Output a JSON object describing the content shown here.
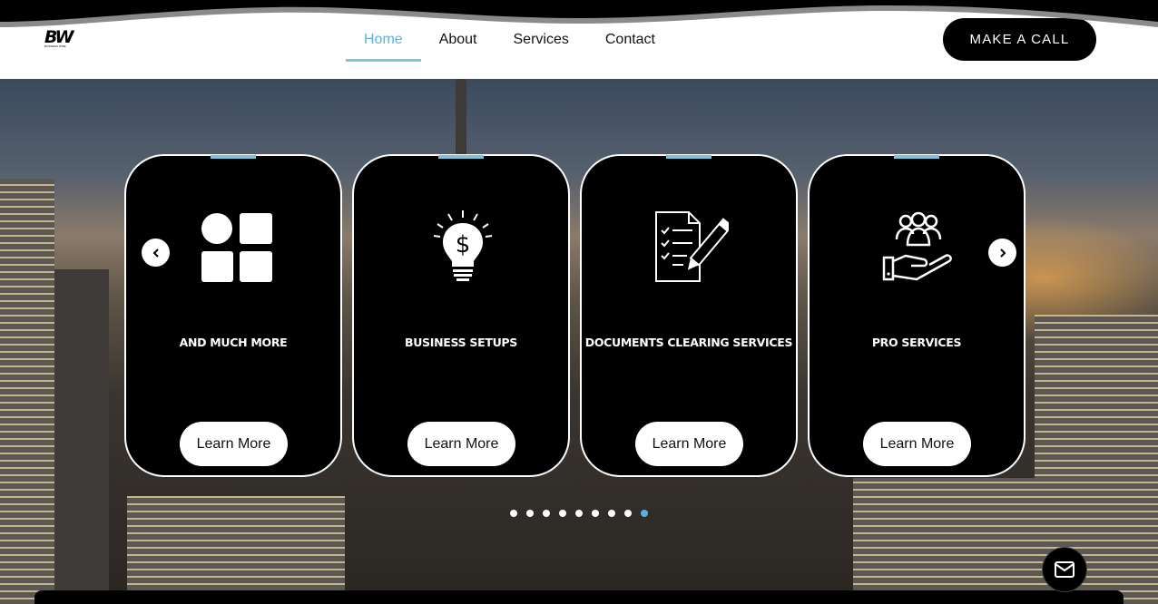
{
  "brand": {
    "logo_text": "BW",
    "logo_subtext": "BUSINESS WISE"
  },
  "nav": {
    "items": [
      {
        "label": "Home",
        "active": true
      },
      {
        "label": "About",
        "active": false
      },
      {
        "label": "Services",
        "active": false
      },
      {
        "label": "Contact",
        "active": false
      }
    ]
  },
  "cta": {
    "label": "MAKE A CALL"
  },
  "carousel": {
    "prev_icon": "chevron-left-icon",
    "next_icon": "chevron-right-icon",
    "cards": [
      {
        "title": "AND MUCH MORE",
        "button": "Learn More",
        "icon": "grid-shapes-icon"
      },
      {
        "title": "BUSINESS SETUPS",
        "button": "Learn More",
        "icon": "lightbulb-dollar-icon"
      },
      {
        "title": "DOCUMENTS CLEARING SERVICES",
        "button": "Learn More",
        "icon": "document-pen-icon"
      },
      {
        "title": "PRO SERVICES",
        "button": "Learn More",
        "icon": "people-hand-icon"
      }
    ],
    "page_count": 9,
    "active_page": 9
  },
  "colors": {
    "accent": "#7ec3dd",
    "active_nav": "#5ab3dd",
    "card_bg": "#000000"
  },
  "floating": {
    "mail_icon": "mail-icon"
  }
}
